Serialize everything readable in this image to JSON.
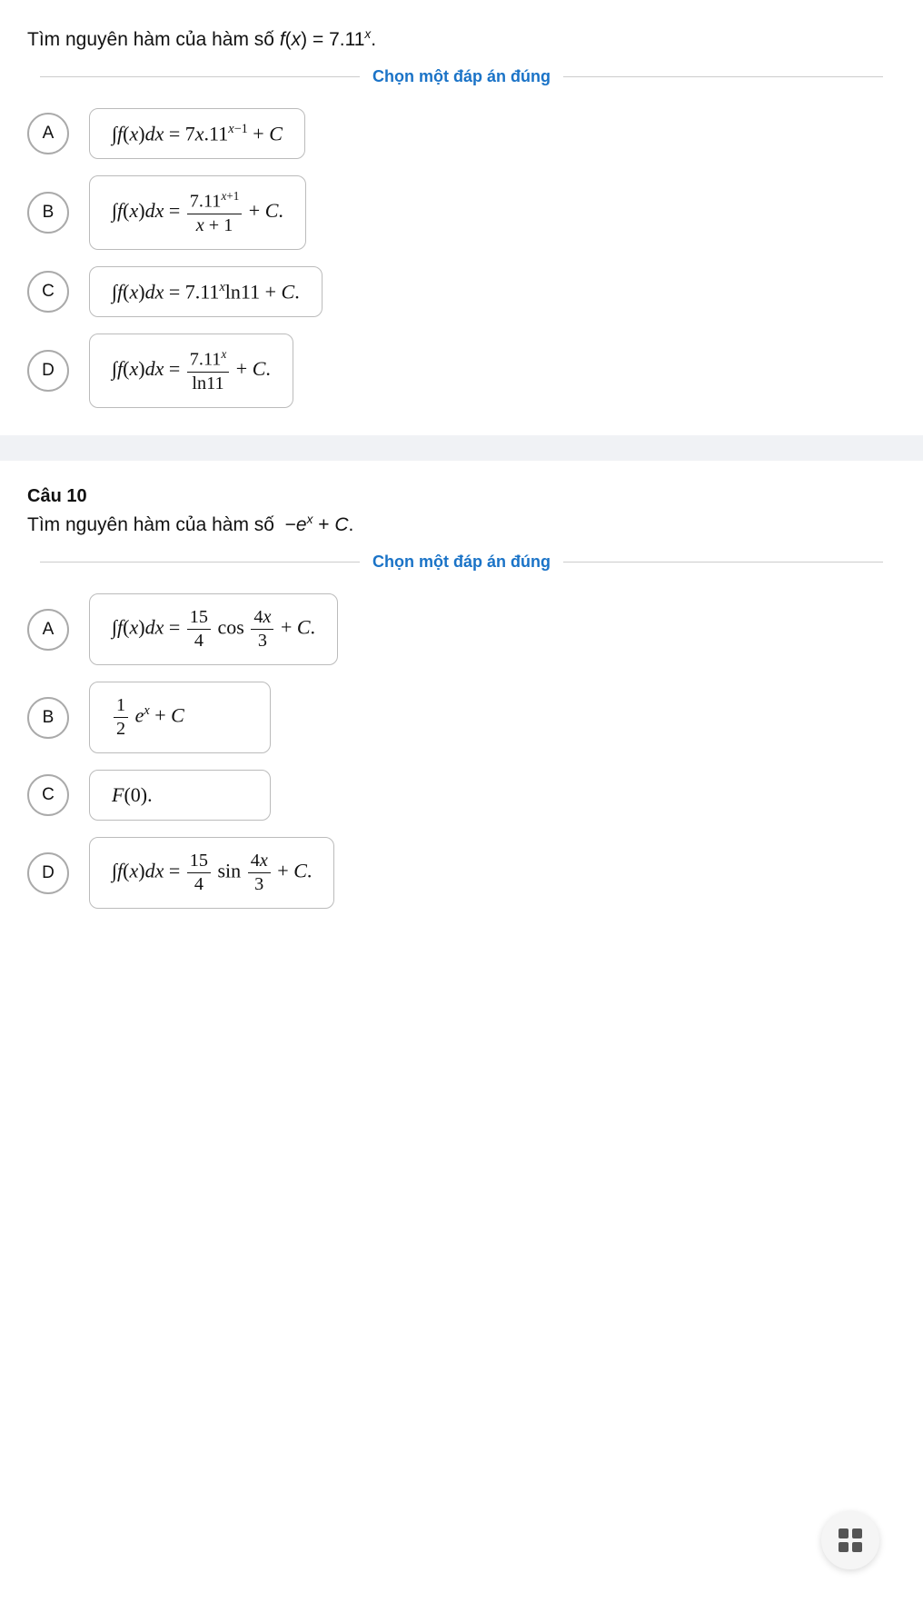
{
  "question9": {
    "preamble": "Tìm nguyên hàm của hàm số",
    "function_display": "f(x) = 7.11",
    "exponent": "x",
    "choose_label": "Chọn một đáp án đúng",
    "options": [
      {
        "label": "A",
        "html_key": "opt9A"
      },
      {
        "label": "B",
        "html_key": "opt9B"
      },
      {
        "label": "C",
        "html_key": "opt9C"
      },
      {
        "label": "D",
        "html_key": "opt9D"
      }
    ]
  },
  "question10": {
    "number": "Câu 10",
    "preamble": "Tìm nguyên hàm của hàm số",
    "function_display": "−e",
    "exponent": "x",
    "suffix": "+ C.",
    "choose_label": "Chọn một đáp án đúng",
    "options": [
      {
        "label": "A",
        "html_key": "opt10A"
      },
      {
        "label": "B",
        "html_key": "opt10B"
      },
      {
        "label": "C",
        "html_key": "opt10C"
      },
      {
        "label": "D",
        "html_key": "opt10D"
      }
    ]
  }
}
